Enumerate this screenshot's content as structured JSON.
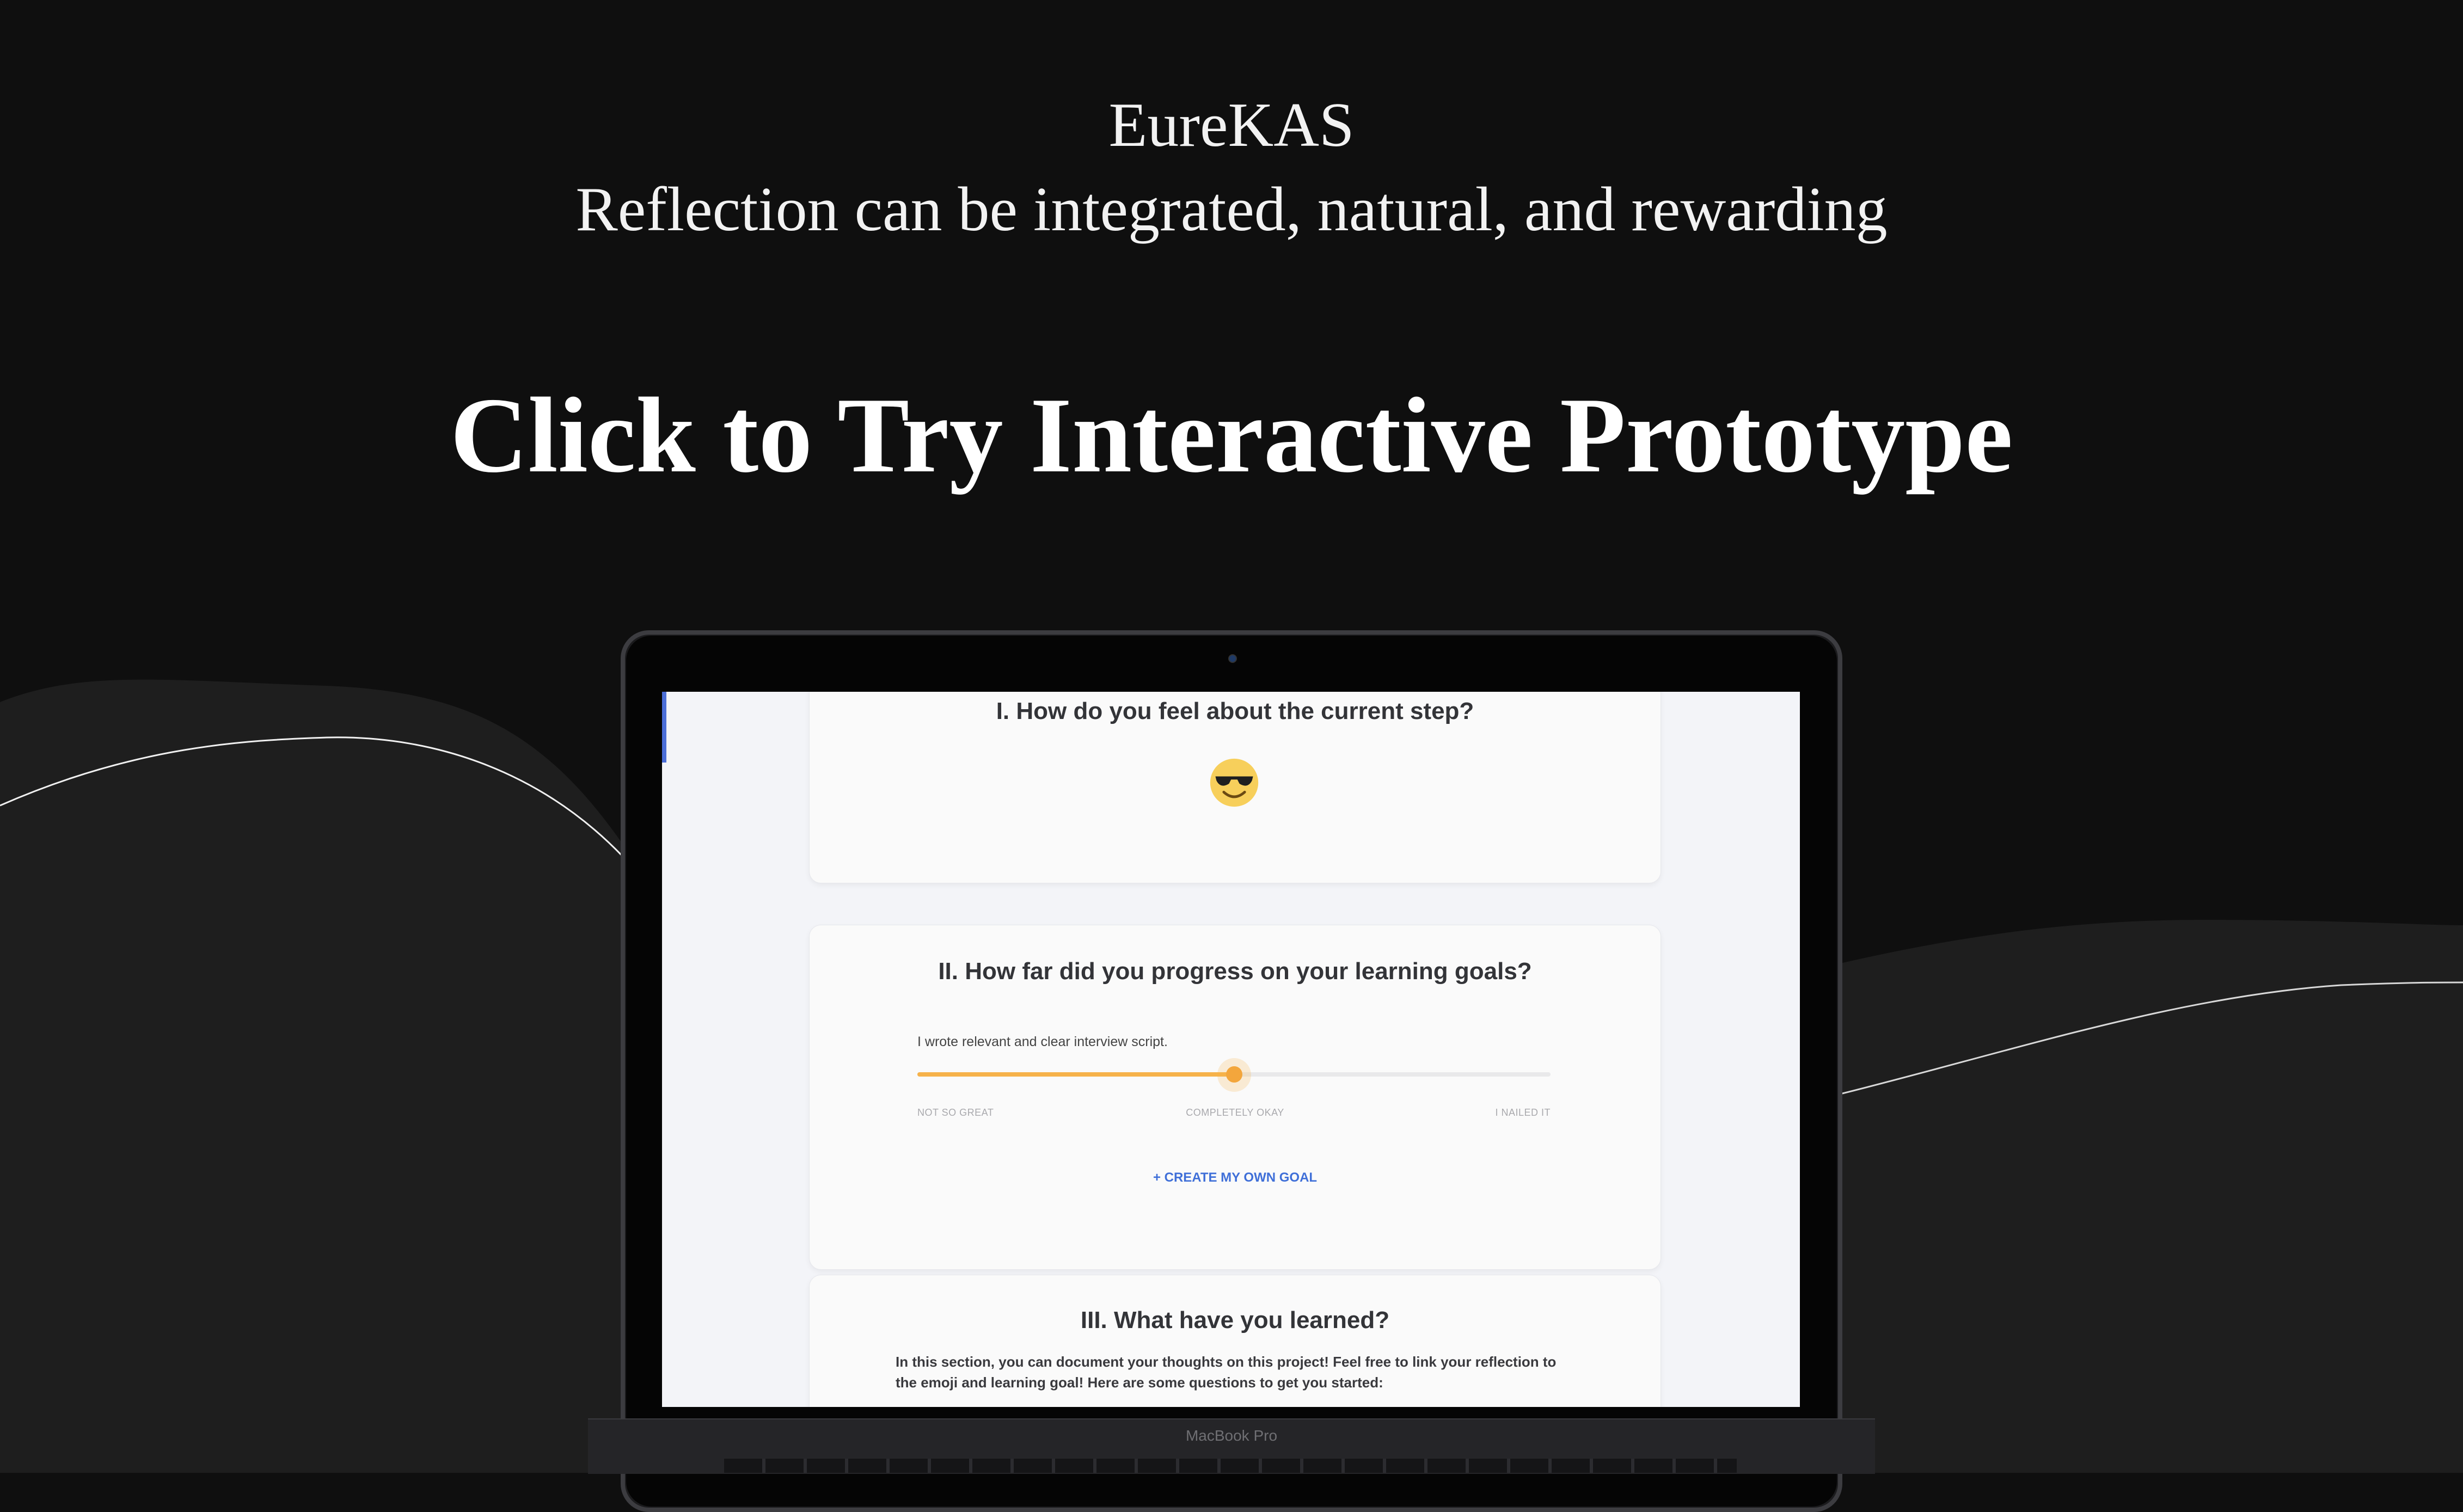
{
  "header": {
    "title": "EureKAS",
    "tagline": "Reflection can be integrated, natural, and rewarding",
    "cta": "Click to Try Interactive Prototype"
  },
  "device": {
    "label": "MacBook Pro"
  },
  "reflection": {
    "feel": {
      "heading": "I. How do you feel about the current step?",
      "emoji": "smiling-face-with-sunglasses"
    },
    "progress": {
      "heading": "II. How far did you progress on your learning goals?",
      "goal": "I wrote relevant and clear interview script.",
      "slider_value_fraction": 0.5,
      "scale_low": "NOT SO GREAT",
      "scale_mid": "COMPLETELY OKAY",
      "scale_high": "I NAILED IT",
      "create_goal": "+ CREATE MY OWN GOAL"
    },
    "learned": {
      "heading": "III. What have you learned?",
      "intro": "In this section, you can document your thoughts on this project! Feel free to link your reflection to the emoji and learning goal! Here are some questions to get you started:"
    }
  },
  "colors": {
    "background": "#0f0f0f",
    "accent": "#3f6fd8",
    "slider": "#f6b24a"
  }
}
